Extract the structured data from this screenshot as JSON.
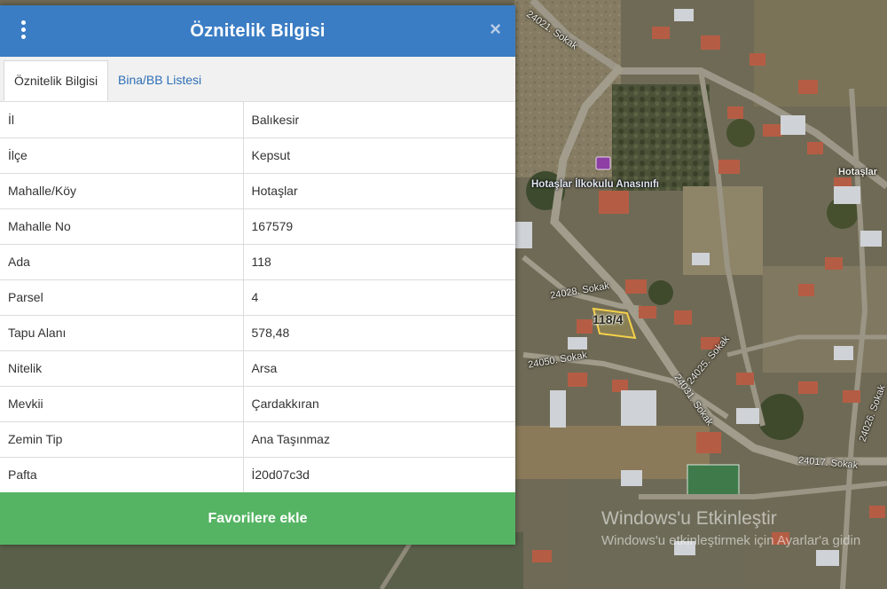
{
  "panel": {
    "title": "Öznitelik Bilgisi",
    "menu_icon": "vertical-dots-icon",
    "close_icon": "close-icon",
    "close_glyph": "×",
    "tabs": [
      {
        "label": "Öznitelik Bilgisi",
        "active": true
      },
      {
        "label": "Bina/BB Listesi",
        "active": false
      }
    ],
    "rows": [
      {
        "key": "İl",
        "value": "Balıkesir"
      },
      {
        "key": "İlçe",
        "value": "Kepsut"
      },
      {
        "key": "Mahalle/Köy",
        "value": "Hotaşlar"
      },
      {
        "key": "Mahalle No",
        "value": "167579"
      },
      {
        "key": "Ada",
        "value": "118"
      },
      {
        "key": "Parsel",
        "value": "4"
      },
      {
        "key": "Tapu Alanı",
        "value": "578,48"
      },
      {
        "key": "Nitelik",
        "value": "Arsa"
      },
      {
        "key": "Mevkii",
        "value": "Çardakkıran"
      },
      {
        "key": "Zemin Tip",
        "value": "Ana Taşınmaz"
      },
      {
        "key": "Pafta",
        "value": "İ20d07c3d"
      }
    ],
    "favorite_button": "Favorilere ekle",
    "colors": {
      "header": "#3b7dc4",
      "button": "#55b463",
      "tab_link": "#2f6fb5"
    }
  },
  "map": {
    "school_label": "Hotaşlar İlkokulu Anasınıfı",
    "village_label": "Hotaşlar",
    "parcel_label": "118/4",
    "streets": [
      "24021. Sokak",
      "24028. Sokak",
      "24050. Sokak",
      "24025. Sokak",
      "24031. Sokak",
      "24026. Sokak",
      "24017. Sokak"
    ]
  },
  "watermark": {
    "line1": "Windows'u Etkinleştir",
    "line2": "Windows'u etkinleştirmek için Ayarlar'a gidin"
  }
}
